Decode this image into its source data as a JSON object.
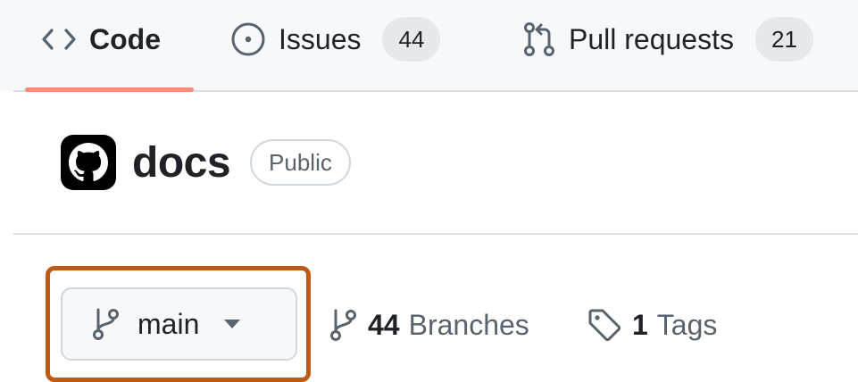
{
  "nav": {
    "tabs": [
      {
        "label": "Code",
        "icon": "code-icon"
      },
      {
        "label": "Issues",
        "icon": "issue-opened-icon",
        "count": "44"
      },
      {
        "label": "Pull requests",
        "icon": "git-pull-request-icon",
        "count": "21"
      }
    ],
    "active_tab": "Code"
  },
  "repo": {
    "name": "docs",
    "visibility": "Public",
    "avatar_icon": "github-mark-icon"
  },
  "branch_selector": {
    "current": "main",
    "icon": "git-branch-icon",
    "caret_icon": "triangle-down-icon"
  },
  "meta": {
    "branches_count": "44",
    "branches_label": "Branches",
    "tags_count": "1",
    "tags_label": "Tags"
  },
  "colors": {
    "active_tab_underline": "#fd8c73",
    "highlight_outline": "#bf5a14",
    "muted_text": "#59636e",
    "counter_bg": "#e6e8eb"
  }
}
